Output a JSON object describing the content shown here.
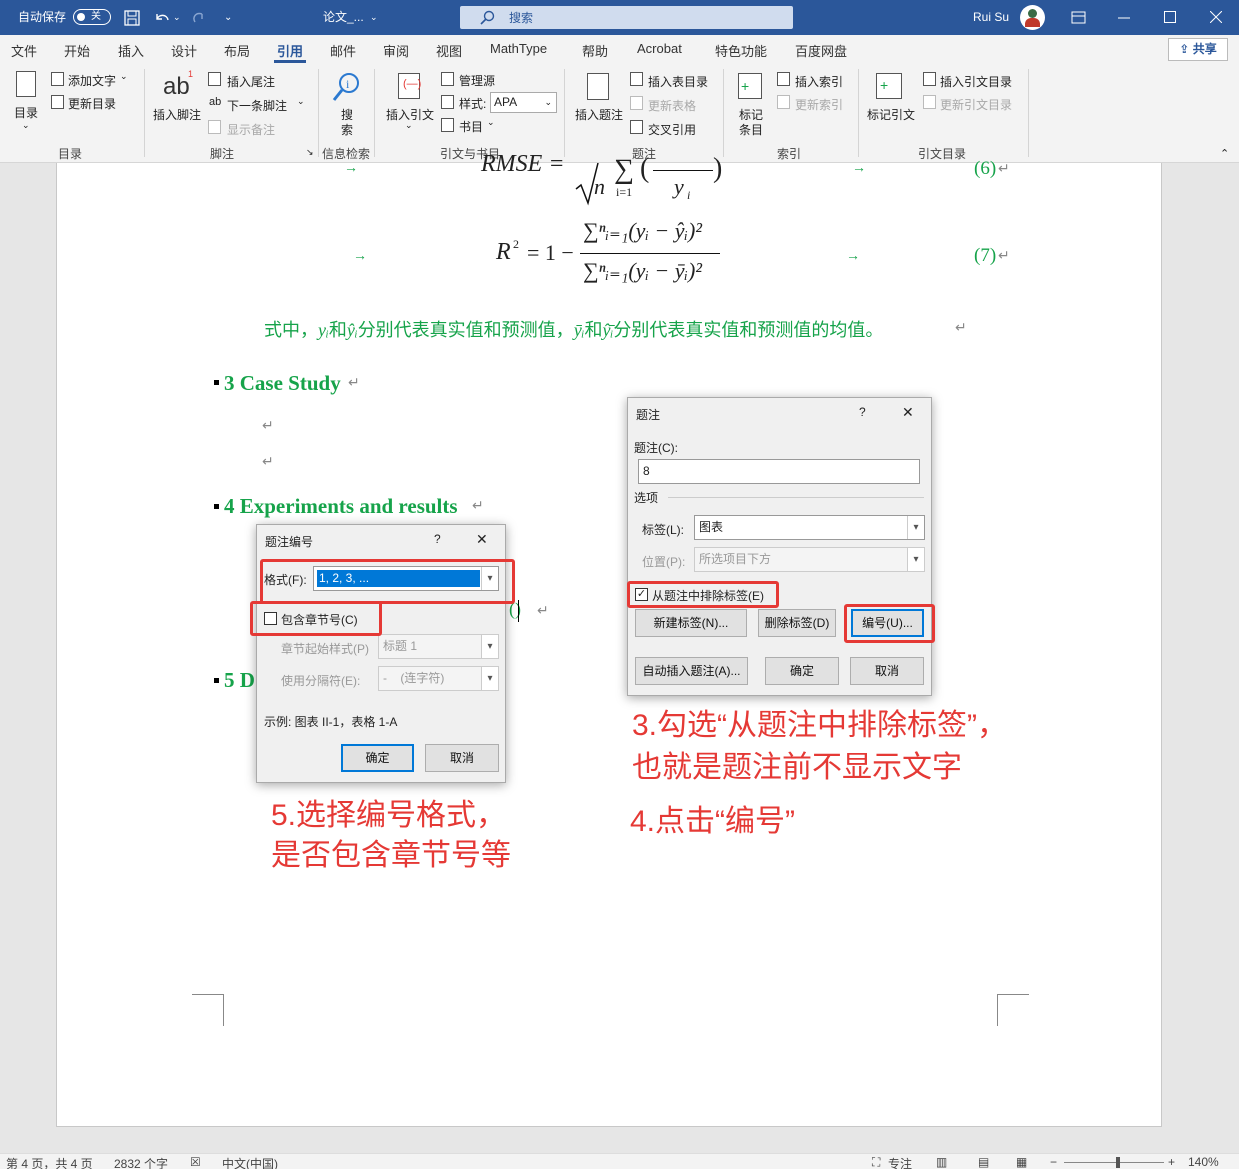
{
  "titlebar": {
    "autosave": "自动保存",
    "autosave_toggle": "关",
    "doc_title": "论文_...",
    "search_placeholder": "搜索",
    "user": "Rui Su"
  },
  "menu": {
    "tabs": [
      "文件",
      "开始",
      "插入",
      "设计",
      "布局",
      "引用",
      "邮件",
      "审阅",
      "视图",
      "MathType",
      "帮助",
      "Acrobat",
      "特色功能",
      "百度网盘"
    ],
    "active_tab": "引用",
    "share": "共享"
  },
  "ribbon": {
    "toc": {
      "label": "目录",
      "add_text": "添加文字",
      "update_toc": "更新目录",
      "group": "目录"
    },
    "footnotes": {
      "insert_footnote": "插入脚注",
      "insert_endnote": "插入尾注",
      "next_footnote": "下一条脚注",
      "show_notes": "显示备注",
      "group": "脚注"
    },
    "research": {
      "search": "搜",
      "search2": "索",
      "group": "信息检索"
    },
    "citations": {
      "insert_citation": "插入引文",
      "manage_sources": "管理源",
      "style_label": "样式:",
      "style_value": "APA",
      "bibliography": "书目",
      "group": "引文与书目"
    },
    "captions": {
      "insert_caption": "插入题注",
      "insert_tof": "插入表目录",
      "update_table": "更新表格",
      "cross_ref": "交叉引用",
      "group": "题注"
    },
    "index": {
      "mark_entry_1": "标记",
      "mark_entry_2": "条目",
      "insert_index": "插入索引",
      "update_index": "更新索引",
      "group": "索引"
    },
    "toa": {
      "mark_citation": "标记引文",
      "insert_toa": "插入引文目录",
      "update_toa": "更新引文目录",
      "group": "引文目录"
    }
  },
  "document": {
    "eq6_lhs": "RMSE =",
    "eq6_n": "n",
    "eq6_sub": "i=1",
    "eq6_frac": "y",
    "eq6_frac_sub": "i",
    "eq6_num": "(6)",
    "eq7_lhs": "R",
    "eq7_sup": "2",
    "eq7_rest": "= 1 −",
    "eq7_numer": "∑ⁿᵢ₌₁(yᵢ − ŷᵢ)²",
    "eq7_denom": "∑ⁿᵢ₌₁(yᵢ − ȳᵢ)²",
    "eq7_num": "(7)",
    "para_a": "式中，",
    "para_yi": "yᵢ",
    "para_b": "和",
    "para_yhat": "ŷᵢ",
    "para_c": "分别代表真实值和预测值，",
    "para_ybar": "ȳᵢ",
    "para_d": "和",
    "para_yhatbar": "ŷ̄ᵢ",
    "para_e": "分别代表真实值和预测值的均值。",
    "h3": "3 Case Study",
    "h4": "4 Experiments and results",
    "h5": "5 D",
    "inline_paren": "()",
    "para_mark": "↵",
    "tab_arrow": "→"
  },
  "caption_dialog": {
    "title": "题注",
    "help": "?",
    "close": "✕",
    "caption_label": "题注(C):",
    "caption_value": "8",
    "options_label": "选项",
    "label_label": "标签(L):",
    "label_value": "图表",
    "position_label": "位置(P):",
    "position_value": "所选项目下方",
    "exclude_label": "从题注中排除标签(E)",
    "exclude_checked": true,
    "btn_new": "新建标签(N)...",
    "btn_delete": "删除标签(D)",
    "btn_numbering": "编号(U)...",
    "btn_autoinsert": "自动插入题注(A)...",
    "btn_ok": "确定",
    "btn_cancel": "取消"
  },
  "numbering_dialog": {
    "title": "题注编号",
    "help": "?",
    "close": "✕",
    "format_label": "格式(F):",
    "format_value": "1, 2, 3, ...",
    "include_chapter": "包含章节号(C)",
    "include_checked": false,
    "chapter_style_label": "章节起始样式(P)",
    "chapter_style_value": "标题 1",
    "separator_label": "使用分隔符(E):",
    "separator_value": "-    (连字符)",
    "example": "示例:  图表 II-1，表格 1-A",
    "btn_ok": "确定",
    "btn_cancel": "取消"
  },
  "annotations": {
    "step3_line1": "3.勾选“从题注中排除标签”，",
    "step3_line2": "也就是题注前不显示文字",
    "step4": "4.点击“编号”",
    "step5_line1": "5.选择编号格式，",
    "step5_line2": "是否包含章节号等",
    "color": "#e53935"
  },
  "statusbar": {
    "page": "第 4 页，共 4 页",
    "words": "2832 个字",
    "language": "中文(中国)",
    "focus": "专注",
    "zoom": "140%"
  },
  "colors": {
    "title_bar": "#2b579a",
    "heading_green": "#16a34a",
    "annotation_red": "#e53935"
  }
}
